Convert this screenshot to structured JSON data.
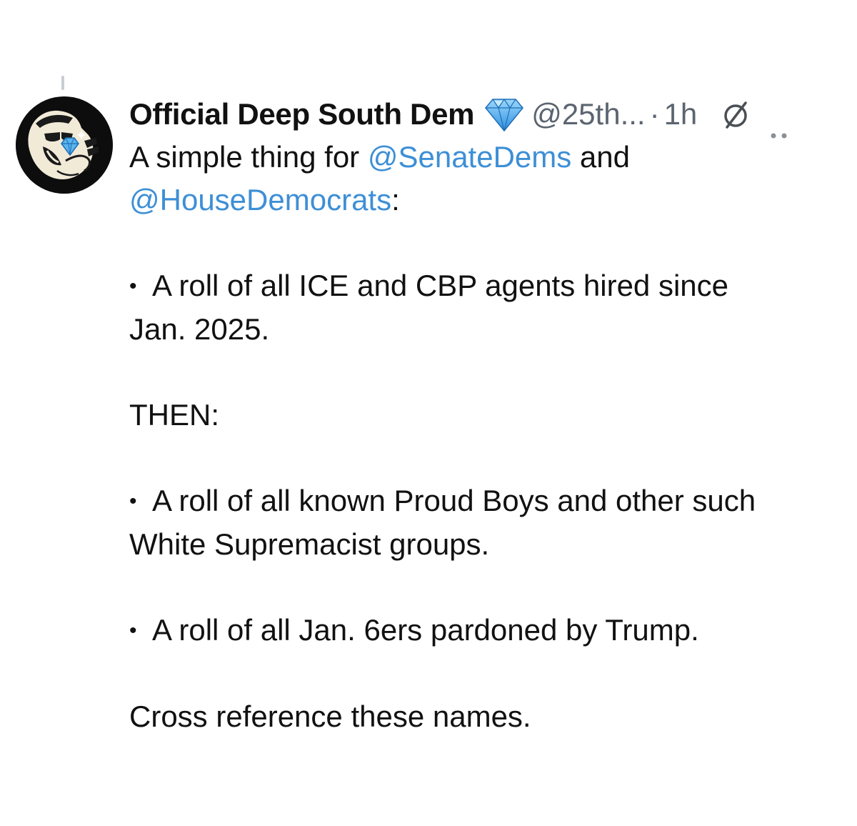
{
  "author": {
    "display_name": "Official Deep South Dem",
    "handle": "@25th...",
    "separator": "·",
    "time": "1h"
  },
  "icons": {
    "verified": "diamond-icon",
    "status": "null-circle-icon",
    "more": "more-dots-icon"
  },
  "colors": {
    "mention": "#3d8fd6",
    "meta": "#5b6570",
    "diamond": "#5ab4f0"
  },
  "tweet": {
    "intro_prefix": "A simple thing for ",
    "mention_senate": "@SenateDems",
    "intro_and": " and",
    "mention_house": "@HouseDemocrats",
    "intro_colon": ":",
    "bullet_char": "•",
    "bullet1_line1": "A roll of all ICE and CBP agents hired since",
    "bullet1_line2": "Jan. 2025.",
    "then": "THEN:",
    "bullet2_line1": "A roll of all known Proud Boys and other such",
    "bullet2_line2": "White Supremacist groups.",
    "bullet3": "A roll of all Jan. 6ers pardoned by Trump.",
    "closing": "Cross reference these names."
  }
}
